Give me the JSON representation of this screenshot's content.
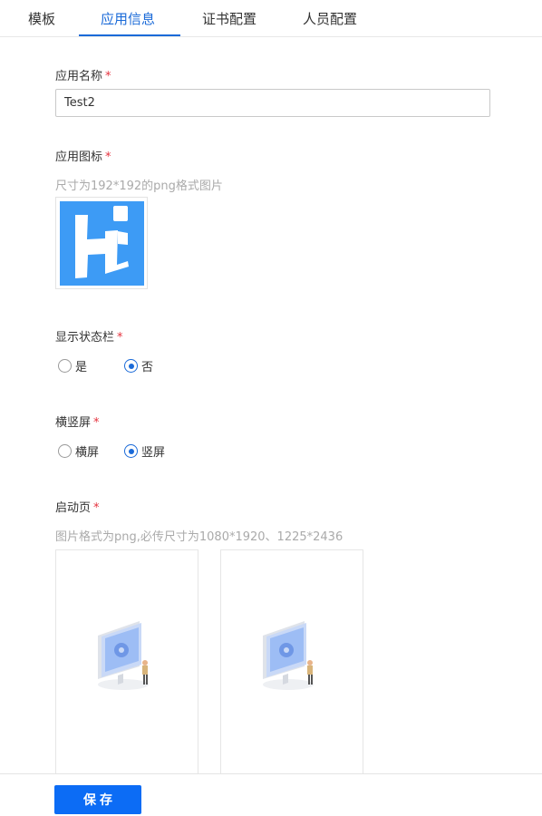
{
  "tabs": [
    {
      "label": "模板",
      "active": false
    },
    {
      "label": "应用信息",
      "active": true
    },
    {
      "label": "证书配置",
      "active": false
    },
    {
      "label": "人员配置",
      "active": false
    }
  ],
  "form": {
    "app_name": {
      "label": "应用名称",
      "required_mark": "*",
      "value": "Test2"
    },
    "app_icon": {
      "label": "应用图标",
      "required_mark": "*",
      "hint": "尺寸为192*192的png格式图片",
      "icon_color": "#3d9bf5",
      "icon_name": "hi-logo-icon"
    },
    "status_bar": {
      "label": "显示状态栏",
      "required_mark": "*",
      "options": [
        "是",
        "否"
      ],
      "selected": "否"
    },
    "orientation": {
      "label": "横竖屏",
      "required_mark": "*",
      "options": [
        "横屏",
        "竖屏"
      ],
      "selected": "竖屏"
    },
    "splash": {
      "label": "启动页",
      "required_mark": "*",
      "hint": "图片格式为png,必传尺寸为1080*1920、1225*2436",
      "placeholder_icon": "computer-illustration-icon"
    }
  },
  "footer": {
    "save_label": "保存"
  },
  "colors": {
    "accent": "#1a6ad8",
    "button": "#0c6cf5",
    "required": "#e5323e",
    "hint": "#aaaaaa"
  }
}
